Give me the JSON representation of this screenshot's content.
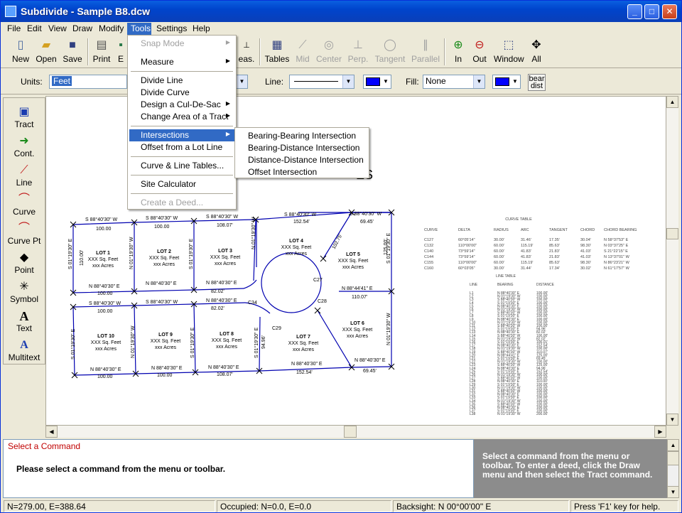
{
  "window": {
    "title": "Subdivide - Sample B8.dcw"
  },
  "menubar": [
    "File",
    "Edit",
    "View",
    "Draw",
    "Modify",
    "Tools",
    "Settings",
    "Help"
  ],
  "toolbar": {
    "buttons": [
      {
        "label": "New",
        "icon": "new-page-icon"
      },
      {
        "label": "Open",
        "icon": "folder-open-icon"
      },
      {
        "label": "Save",
        "icon": "floppy-disk-icon"
      },
      {
        "label": "Print",
        "icon": "printer-icon"
      },
      {
        "label": "E",
        "icon": "export-icon"
      }
    ],
    "hidden_label": "eas.",
    "snap_buttons": [
      {
        "label": "Tables",
        "icon": "table-icon",
        "enabled": true
      },
      {
        "label": "Mid",
        "icon": "midpoint-icon",
        "enabled": false
      },
      {
        "label": "Center",
        "icon": "center-icon",
        "enabled": false
      },
      {
        "label": "Perp.",
        "icon": "perpendicular-icon",
        "enabled": false
      },
      {
        "label": "Tangent",
        "icon": "tangent-icon",
        "enabled": false
      },
      {
        "label": "Parallel",
        "icon": "parallel-icon",
        "enabled": false
      }
    ],
    "zoom_buttons": [
      {
        "label": "In",
        "icon": "zoom-in-icon"
      },
      {
        "label": "Out",
        "icon": "zoom-out-icon"
      },
      {
        "label": "Window",
        "icon": "zoom-window-icon"
      },
      {
        "label": "All",
        "icon": "zoom-all-icon"
      }
    ]
  },
  "propbar": {
    "units_label": "Units:",
    "units_value": "Feet",
    "line_label": "Line:",
    "line_color": "#0000ff",
    "fill_label": "Fill:",
    "fill_value": "None",
    "fill_color": "#0000ff",
    "bear_label": "bear",
    "dist_label": "dist"
  },
  "lefttools": [
    {
      "label": "Tract",
      "icon": "tract-icon"
    },
    {
      "label": "Cont.",
      "icon": "continue-icon"
    },
    {
      "label": "Line",
      "icon": "line-icon"
    },
    {
      "label": "Curve",
      "icon": "curve-icon"
    },
    {
      "label": "Curve Pt",
      "icon": "curve-point-icon"
    },
    {
      "label": "Point",
      "icon": "point-icon"
    },
    {
      "label": "Symbol",
      "icon": "symbol-icon"
    },
    {
      "label": "Text",
      "icon": "text-icon"
    },
    {
      "label": "Multitext",
      "icon": "multitext-icon"
    }
  ],
  "tools_menu": [
    {
      "label": "Snap Mode",
      "enabled": false,
      "submenu": true
    },
    {
      "label": "Measure",
      "enabled": true,
      "submenu": true
    },
    {
      "sep": true
    },
    {
      "label": "Divide Line",
      "enabled": true
    },
    {
      "label": "Divide Curve",
      "enabled": true
    },
    {
      "label": "Design a Cul-De-Sac",
      "enabled": true,
      "submenu": true
    },
    {
      "label": "Change Area of a Tract",
      "enabled": true,
      "submenu": true
    },
    {
      "sep": true
    },
    {
      "label": "Intersections",
      "enabled": true,
      "submenu": true,
      "highlight": true
    },
    {
      "label": "Offset from a Lot Line",
      "enabled": true
    },
    {
      "sep": true
    },
    {
      "label": "Curve & Line Tables...",
      "enabled": true
    },
    {
      "sep": true
    },
    {
      "label": "Site Calculator",
      "enabled": true
    },
    {
      "sep": true
    },
    {
      "label": "Create a Deed...",
      "enabled": false
    }
  ],
  "intersections_submenu": [
    "Bearing-Bearing Intersection",
    "Bearing-Distance Intersection",
    "Distance-Distance Intersection",
    "Offset Intersection"
  ],
  "drawing": {
    "partial_title": "ES",
    "lots": [
      {
        "name": "LOT 1",
        "area": "XXX Sq. Feet",
        "acres": "xxx Acres"
      },
      {
        "name": "LOT 2",
        "area": "XXX Sq. Feet",
        "acres": "xxx Acres"
      },
      {
        "name": "LOT 3",
        "area": "XXX Sq. Feet",
        "acres": "xxx Acres"
      },
      {
        "name": "LOT 4",
        "area": "XXX Sq. Feet",
        "acres": "xxx Acres"
      },
      {
        "name": "LOT 5",
        "area": "XXX Sq. Feet",
        "acres": "xxx Acres"
      },
      {
        "name": "LOT 6",
        "area": "XXX Sq. Feet",
        "acres": "xxx Acres"
      },
      {
        "name": "LOT 7",
        "area": "XXX Sq. Feet",
        "acres": "xxx Acres"
      },
      {
        "name": "LOT 8",
        "area": "XXX Sq. Feet",
        "acres": "xxx Acres"
      },
      {
        "name": "LOT 9",
        "area": "XXX Sq. Feet",
        "acres": "xxx Acres"
      },
      {
        "name": "LOT 10",
        "area": "XXX Sq. Feet",
        "acres": "xxx Acres"
      }
    ],
    "labels": {
      "b_s884030w": "S 88°40'30\" W",
      "b_n884030e": "N 88°40'30\" E",
      "b_s011930e": "S 01°19'30\" E",
      "b_n011930w": "N 01°19'30\" W",
      "b_n884441e": "N 88°44'41\" E",
      "d_100": "100.00",
      "d_10800": "108.07'",
      "d_15254": "152.54'",
      "d_6945": "69.45'",
      "d_11000": "110.00'",
      "d_12500": "125.00'",
      "d_11007": "110.07'",
      "d_8202": "82.02'",
      "d_9496": "94.96'",
      "d_10275": "102.75'",
      "d_c27": "C27",
      "d_c28": "C28",
      "d_c29": "C29",
      "d_c34": "C34"
    },
    "curve_table_title": "CURVE TABLE",
    "line_table_title": "LINE TABLE",
    "curve_table_headers": [
      "CURVE",
      "DELTA",
      "RADIUS",
      "ARC",
      "TANGENT",
      "CHORD",
      "CHORD BEARING"
    ],
    "curve_table_rows": [
      [
        "C127",
        "60°05'14\"",
        "30.00'",
        "31.46'",
        "17.35'",
        "30.04'",
        "N 58°37'53\" E"
      ],
      [
        "C132",
        "110°00'00\"",
        "60.00'",
        "115.19'",
        "85.63'",
        "98.30'",
        "N 03°37'25\" E"
      ],
      [
        "C140",
        "73°59'14\"",
        "60.00'",
        "41.83'",
        "21.83'",
        "41.03'",
        "S 21°22'15\" E"
      ],
      [
        "C144",
        "73°59'14\"",
        "60.00'",
        "41.83'",
        "21.83'",
        "41.03'",
        "N 13°37'01\" W"
      ],
      [
        "C155",
        "110°00'00\"",
        "60.00'",
        "115.19'",
        "85.63'",
        "98.30'",
        "N 86°23'21\" W"
      ],
      [
        "C160",
        "60°03'05\"",
        "30.00'",
        "31.44'",
        "17.34'",
        "30.02'",
        "N 61°17'57\" W"
      ]
    ],
    "line_table_headers": [
      "LINE",
      "BEARING",
      "DISTANCE"
    ],
    "line_table_rows": [
      [
        "L1",
        "N 88°40'30\" E",
        "100.00'"
      ],
      [
        "L2",
        "N 01°19'30\" W",
        "100.00'"
      ],
      [
        "L3",
        "S 88°40'30\" W",
        "100.00'"
      ],
      [
        "L4",
        "S 01°19'30\" E",
        "100.00'"
      ],
      [
        "L5",
        "N 88°40'30\" E",
        "100.00'"
      ],
      [
        "L6",
        "N 01°19'30\" W",
        "100.00'"
      ],
      [
        "L7",
        "S 88°40'30\" W",
        "100.00'"
      ],
      [
        "L8",
        "S 01°19'30\" E",
        "100.00'"
      ],
      [
        "L9",
        "N 88°40'30\" E",
        "100.00'"
      ],
      [
        "L10",
        "N 01°19'30\" W",
        "100.00'"
      ],
      [
        "L11",
        "S 88°40'30\" W",
        "100.00'"
      ],
      [
        "L12",
        "S 01°19'30\" E",
        "94.96'"
      ],
      [
        "L13",
        "N 88°40'30\" E",
        "82.02'"
      ],
      [
        "L14",
        "S 88°40'30\" W",
        "100.00'"
      ],
      [
        "L15",
        "N 01°19'30\" W",
        "82.02'"
      ],
      [
        "L16",
        "S 01°19'30\" E",
        "100.01'"
      ],
      [
        "L17",
        "N 88°40'30\" E",
        "152.54'"
      ],
      [
        "L18",
        "N 01°19'30\" W",
        "100.00'"
      ],
      [
        "L19",
        "S 88°40'30\" W",
        "110.07'"
      ],
      [
        "L20",
        "N 88°44'41\" E",
        "125.00'"
      ],
      [
        "L21",
        "S 01°19'30\" E",
        "69.45'"
      ],
      [
        "L22",
        "N 01°19'30\" W",
        "100.00'"
      ],
      [
        "L23",
        "S 88°40'30\" W",
        "125.00'"
      ],
      [
        "L24",
        "N 88°40'30\" E",
        "94.96'"
      ],
      [
        "L25",
        "S 01°19'30\" E",
        "152.54'"
      ],
      [
        "L26",
        "N 01°19'30\" W",
        "100.00'"
      ],
      [
        "L27",
        "S 88°40'30\" W",
        "100.00'"
      ],
      [
        "L28",
        "N 88°40'30\" E",
        "110.00'"
      ],
      [
        "L29",
        "S 01°19'30\" E",
        "100.00'"
      ],
      [
        "L30",
        "N 01°19'30\" W",
        "100.00'"
      ],
      [
        "L31",
        "S 88°40'30\" W",
        "100.00'"
      ],
      [
        "L32",
        "N 88°40'30\" E",
        "100.00'"
      ],
      [
        "L33",
        "S 01°19'30\" E",
        "100.00'"
      ],
      [
        "L34",
        "N 01°19'30\" W",
        "100.00'"
      ],
      [
        "L35",
        "S 88°40'30\" W",
        "100.00'"
      ],
      [
        "L36",
        "N 88°40'30\" E",
        "100.00'"
      ],
      [
        "L37",
        "S 01°19'30\" E",
        "100.00'"
      ],
      [
        "L38",
        "N 01°19'30\" W",
        "200.00'"
      ]
    ]
  },
  "command": {
    "title": "Select a Command",
    "prompt": "Please select a command from the menu or toolbar."
  },
  "help": {
    "text": "Select a command from the menu or toolbar. To enter a deed, click the Draw menu and then select the Tract command."
  },
  "status": {
    "coords": "N=279.00,  E=388.64",
    "occupied": "Occupied:  N=0.0, E=0.0",
    "backsight": "Backsight: N 00°00'00\" E",
    "help": "Press 'F1' key  for help."
  }
}
